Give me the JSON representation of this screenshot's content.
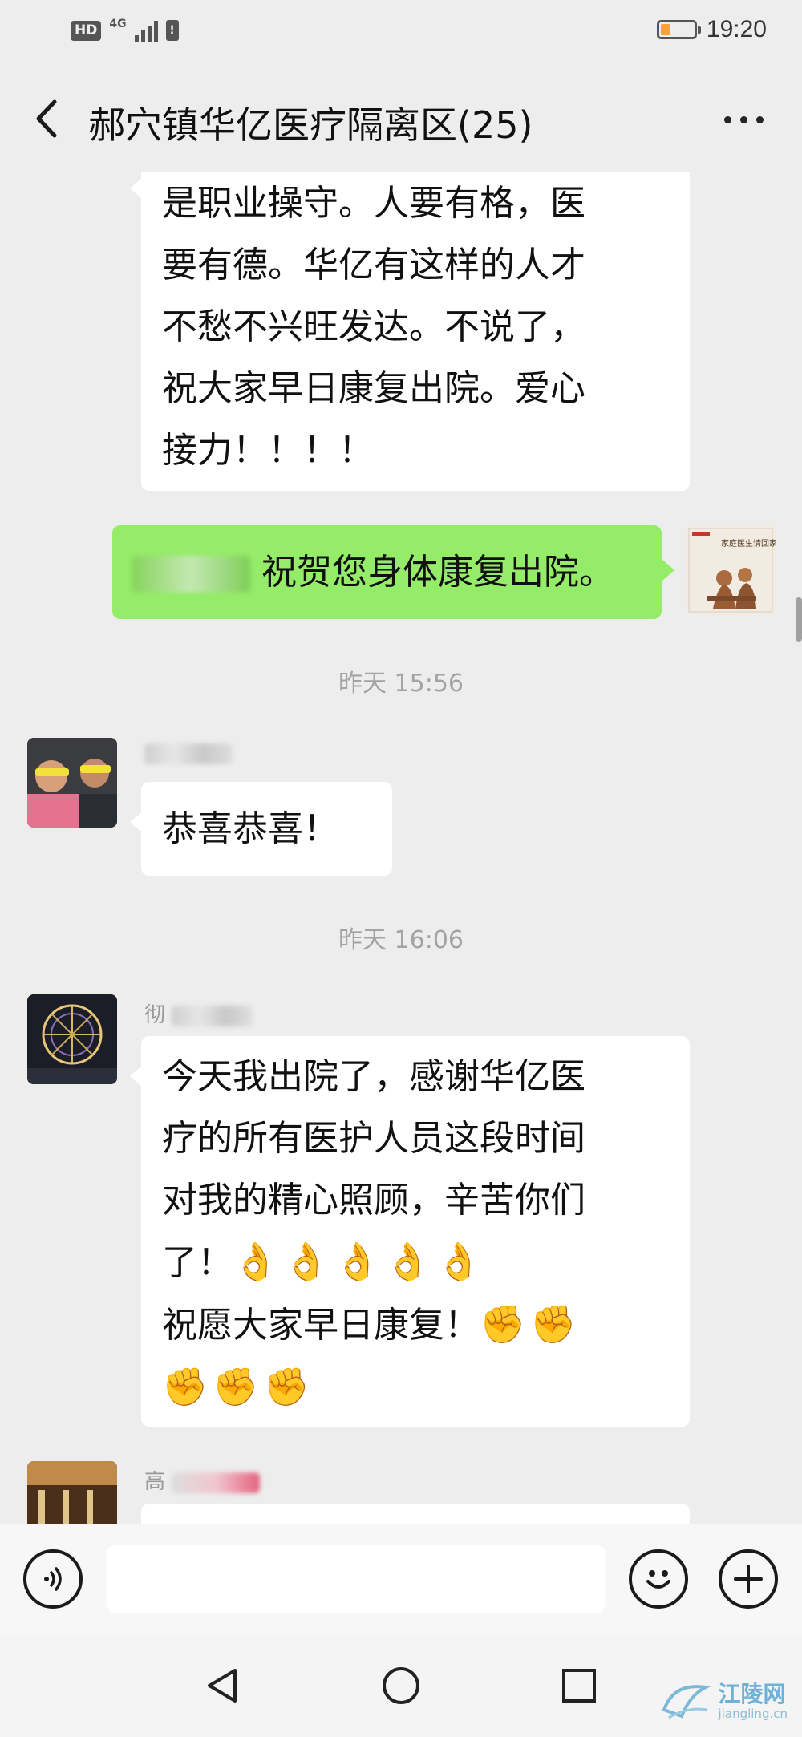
{
  "status_bar": {
    "hd": "HD",
    "network": "4G",
    "sim": "!",
    "time": "19:20",
    "battery_fraction": 0.3,
    "battery_color": "#f5a23a"
  },
  "header": {
    "title": "郝穴镇华亿医疗隔离区(25)",
    "back_icon": "chevron-left-icon",
    "more_icon": "more-dots-icon"
  },
  "messages": {
    "m1": {
      "lines": [
        "是职业操守。人要有格，医",
        "要有德。华亿有这样的人才",
        "不愁不兴旺发达。不说了，",
        "祝大家早日康复出院。爱心",
        "接力！！！！"
      ]
    },
    "m2": {
      "text": "祝贺您身体康复出院。",
      "avatar_text_1": "家庭医生请回家"
    },
    "ts1": "昨天 15:56",
    "m3": {
      "text": "恭喜恭喜！"
    },
    "ts2": "昨天 16:06",
    "m4": {
      "name_visible": "彻",
      "lines": [
        "今天我出院了，感谢华亿医",
        "疗的所有医护人员这段时间",
        "对我的精心照顾，辛苦你们"
      ],
      "line4_text": "了！",
      "line4_emoji": "👌👌👌👌👌",
      "line5_text": "祝愿大家早日康复！",
      "line5_emoji": "✊✊",
      "line6_emoji": "✊✊✊"
    },
    "m5": {
      "name_visible": "高"
    }
  },
  "input_bar": {
    "voice_icon": "voice-icon",
    "emoji_icon": "emoji-icon",
    "plus_icon": "plus-icon"
  },
  "nav": {
    "back_icon": "nav-back-icon",
    "home_icon": "nav-home-icon",
    "recents_icon": "nav-recents-icon"
  },
  "watermark": {
    "main": "江陵网",
    "sub": "jiangling.cn"
  },
  "colors": {
    "background": "#ededed",
    "my_bubble": "#95ec69",
    "other_bubble": "#ffffff",
    "accent_orange": "#f5a23a"
  }
}
